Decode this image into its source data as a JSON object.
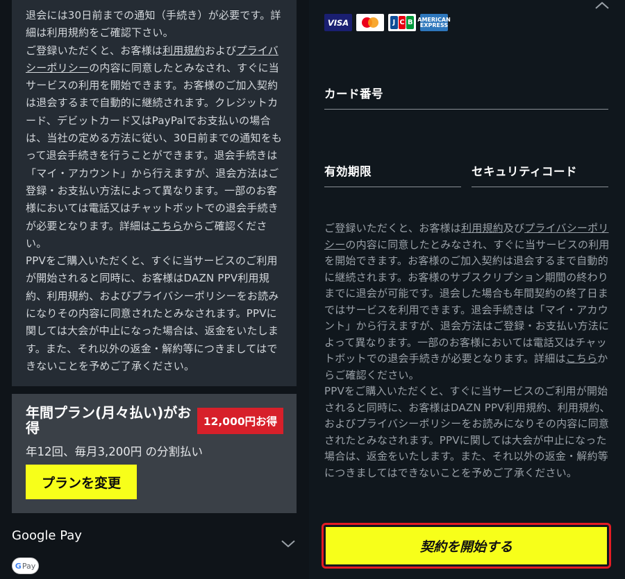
{
  "left": {
    "terms": [
      {
        "text": "退会には30日前までの通知（手続き）が必要です。詳細は利用規約をご確認下さい。"
      },
      {
        "pre": "ご登録いただくと、お客様は",
        "link1": "利用規約",
        "mid": "および",
        "link2": "プライバシーポリシー",
        "post": "の内容に同意したとみなされ、すぐに当サービスの利用を開始できます。お客様のご加入契約は退会するまで自動的に継続されます。クレジットカード、デビットカード又はPayPalでお支払いの場合は、当社の定める方法に従い、30日前までの通知をもって退会手続きを行うことができます。退会手続きは「マイ・アカウント」から行えますが、退会方法はご登録・お支払い方法によって異なります。一部のお客様においては電話又はチャットボットでの退会手続きが必要となります。詳細は",
        "link3": "こちら",
        "post2": "からご確認ください。"
      },
      {
        "text": "PPVをご購入いただくと、すぐに当サービスのご利用が開始されると同時に、お客様はDAZN PPV利用規約、利用規約、およびプライバシーポリシーをお読みになりその内容に同意されたとみなされます。PPVに関しては大会が中止になった場合は、返金をいたします。また、それ以外の返金・解約等につきましてはできないことを予めご了承ください。"
      }
    ],
    "plan": {
      "title": "年間プラン(月々払い)がお得",
      "badge": "12,000円お得",
      "subtitle": "年12回、毎月3,200円 の分割払い",
      "change_button": "プランを変更"
    },
    "google_pay": {
      "label": "Google Pay",
      "badge_g": "G",
      "badge_text": "Pay"
    }
  },
  "right": {
    "cards": {
      "visa": "VISA",
      "jcb": [
        "J",
        "C",
        "B"
      ],
      "amex": [
        "AMERICAN",
        "EXPRESS"
      ]
    },
    "fields": {
      "card_number": "カード番号",
      "expiry": "有効期限",
      "security_code": "セキュリティコード"
    },
    "terms": {
      "pre": "ご登録いただくと、お客様は",
      "link1": "利用規約",
      "mid": "及び",
      "link2": "プライバシーポリシー",
      "post": "の内容に同意したとみなされ、すぐに当サービスの利用を開始できます。お客様のご加入契約は退会するまで自動的に継続されます。お客様のサブスクリプション期間の終わりまでに退会が可能です。退会した場合も年間契約の終了日まではサービスを利用できます。退会手続きは「マイ・アカウント」から行えますが、退会方法はご登録・お支払い方法によって異なります。一部のお客様においては電話又はチャットボットでの退会手続きが必要となります。詳細は",
      "link3": "こちら",
      "post2": "からご確認ください。",
      "ppv": "PPVをご購入いただくと、すぐに当サービスのご利用が開始されると同時に、お客様はDAZN PPV利用規約、利用規約、およびプライバシーポリシーをお読みになりその内容に同意されたとみなされます。PPVに関しては大会が中止になった場合は、返金をいたします。また、それ以外の返金・解約等につきましてはできないことを予めご了承ください。"
    },
    "start_button": "契約を開始する"
  },
  "colors": {
    "accent_yellow": "#f7ff1a",
    "badge_red": "#d7202a",
    "highlight_red": "#e51c24"
  }
}
